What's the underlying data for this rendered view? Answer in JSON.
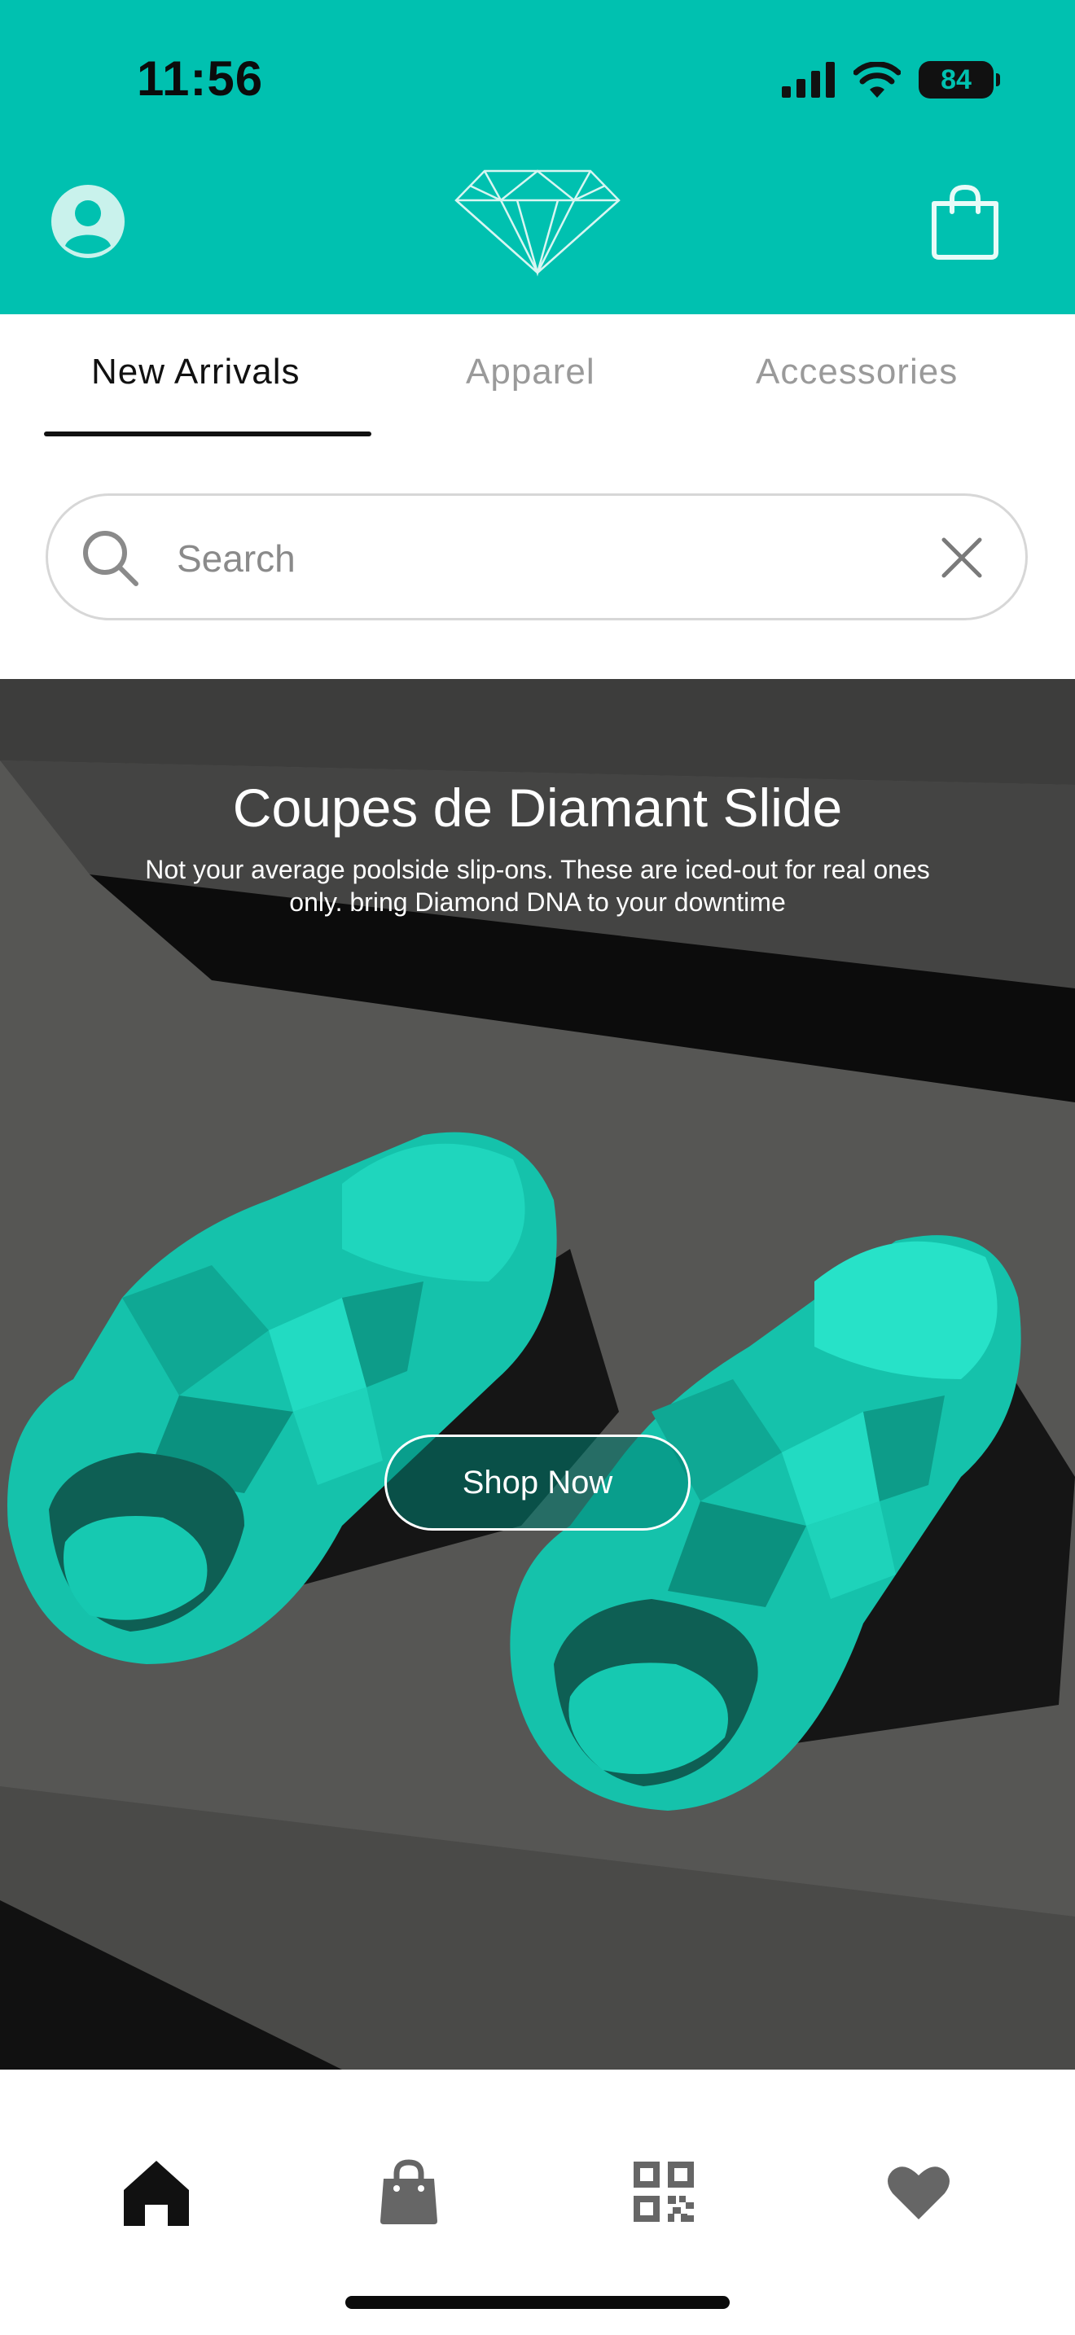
{
  "status_bar": {
    "time": "11:56",
    "battery": "84"
  },
  "header": {
    "profile_icon": "user-circle-icon",
    "logo_icon": "diamond-logo-icon",
    "cart_icon": "shopping-bag-icon"
  },
  "tabs": [
    {
      "label": "New Arrivals",
      "active": true
    },
    {
      "label": "Apparel",
      "active": false
    },
    {
      "label": "Accessories",
      "active": false
    }
  ],
  "search": {
    "placeholder": "Search"
  },
  "hero": {
    "title": "Coupes de Diamant Slide",
    "description": "Not your average poolside slip-ons. These are iced-out for real ones only. bring Diamond DNA to your downtime",
    "cta": "Shop Now"
  },
  "bottom_nav": [
    {
      "icon": "home-icon",
      "active": true
    },
    {
      "icon": "shopping-bag-icon",
      "active": false
    },
    {
      "icon": "qr-code-icon",
      "active": false
    },
    {
      "icon": "heart-icon",
      "active": false
    }
  ],
  "colors": {
    "brand": "#00c1b0",
    "slide": "#16c9b3",
    "text_muted": "#9a9a9a"
  }
}
